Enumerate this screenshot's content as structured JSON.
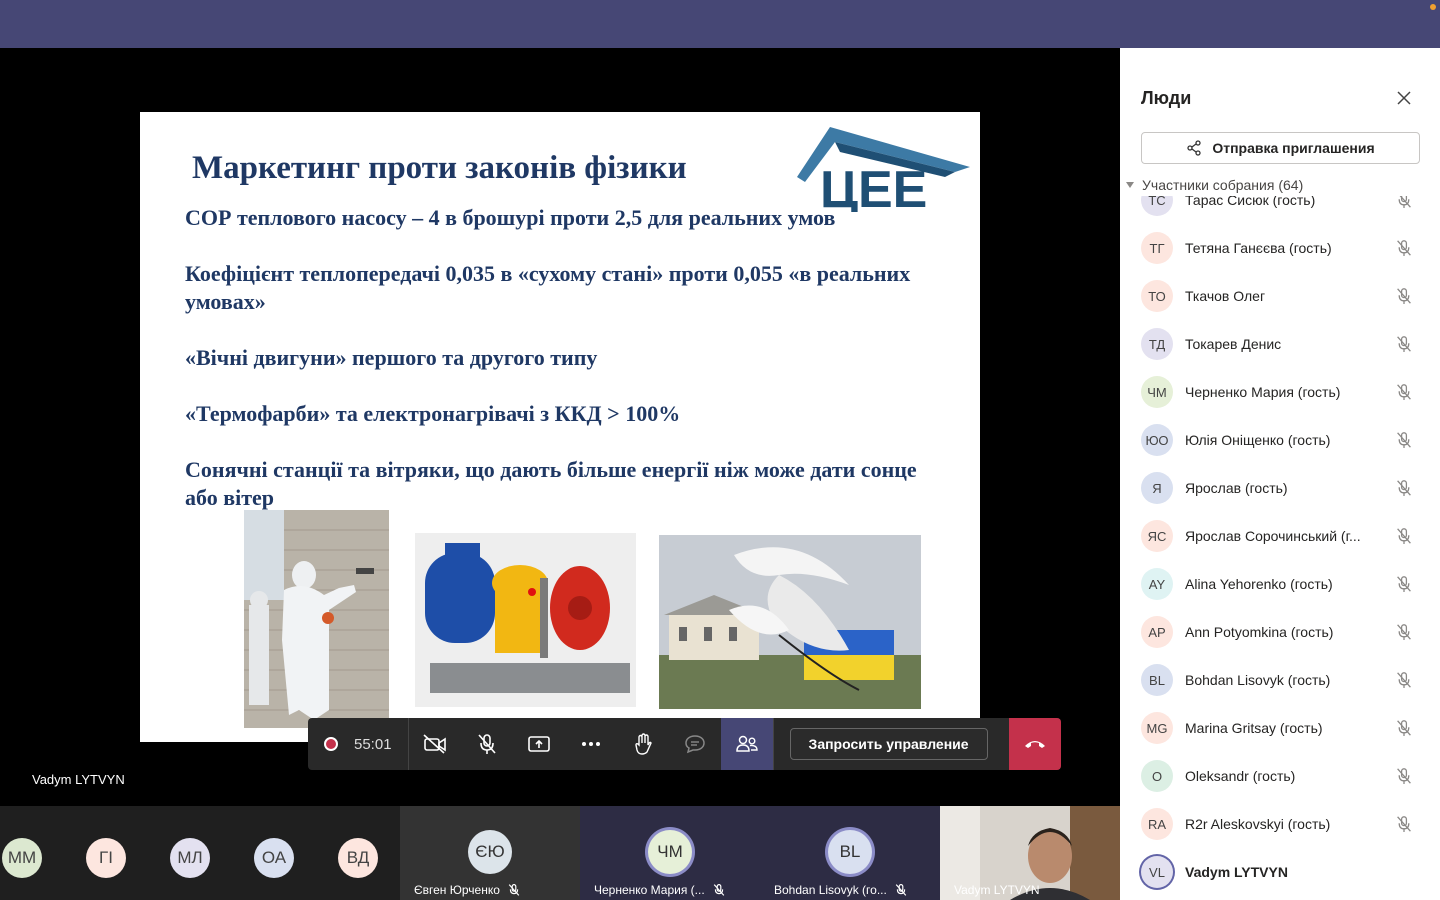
{
  "slide": {
    "title": "Маркетинг проти законів фізики",
    "logo_text": "ЦЕЕ",
    "lines": [
      "СОР теплового насосу – 4 в брошурі проти 2,5 для реальних умов",
      "Коефіцієнт теплопередачі 0,035 в «сухому стані» проти 0,055 «в реальних умовах»",
      "«Вічні двигуни» першого та другого типу",
      "«Термофарби» та електронагрівачі з ККД > 100%",
      "Сонячні станції та вітряки, що дають більше енергії ніж може дати сонце або вітер"
    ]
  },
  "presenter_name": "Vadym LYTVYN",
  "call_bar": {
    "timer": "55:01",
    "request_control": "Запросить управление"
  },
  "strip": {
    "mini_avatars": [
      "MM",
      "ГІ",
      "МЛ",
      "ОА",
      "ВД"
    ],
    "tiles": [
      {
        "initials": "ЄЮ",
        "name": "Євген Юрченко"
      },
      {
        "initials": "ЧМ",
        "name": "Черненко Мария (..."
      },
      {
        "initials": "BL",
        "name": "Bohdan Lisovyk (го..."
      },
      {
        "initials": "",
        "name": "Vadym LYTVYN"
      }
    ]
  },
  "panel": {
    "title": "Люди",
    "invite_label": "Отправка приглашения",
    "section_label": "Участники собрания (64)",
    "participants": [
      {
        "initials": "ТС",
        "name": "Тарас Сисюк (гость)",
        "color": "#e3e1f0"
      },
      {
        "initials": "ТГ",
        "name": "Тетяна Ганєєва (гость)",
        "color": "#fde6df"
      },
      {
        "initials": "ТО",
        "name": "Ткачов Олег",
        "color": "#fde6df"
      },
      {
        "initials": "ТД",
        "name": "Токарев Денис",
        "color": "#e3e1f0"
      },
      {
        "initials": "ЧМ",
        "name": "Черненко Мария (гость)",
        "color": "#e6f0d8"
      },
      {
        "initials": "ЮО",
        "name": "Юлія Оніщенко (гость)",
        "color": "#d9e0f0"
      },
      {
        "initials": "Я",
        "name": "Ярослав (гость)",
        "color": "#d9e0f0"
      },
      {
        "initials": "ЯС",
        "name": "Ярослав Сорочинський (г...",
        "color": "#fde6df"
      },
      {
        "initials": "AY",
        "name": "Alina Yehorenko (гость)",
        "color": "#dff3f3"
      },
      {
        "initials": "AP",
        "name": "Ann Potyomkina (гость)",
        "color": "#fde6df"
      },
      {
        "initials": "BL",
        "name": "Bohdan Lisovyk (гость)",
        "color": "#d9e0f0"
      },
      {
        "initials": "MG",
        "name": "Marina Gritsay (гость)",
        "color": "#fde6df"
      },
      {
        "initials": "O",
        "name": "Oleksandr (гость)",
        "color": "#dcefe4"
      },
      {
        "initials": "RA",
        "name": "R2r Aleskovskyi (гость)",
        "color": "#fde6df"
      },
      {
        "initials": "VL",
        "name": "Vadym LYTVYN",
        "color": "#e3e1f0"
      }
    ]
  },
  "colors": {
    "teams_purple": "#464775",
    "slide_text": "#1f3864",
    "hangup_red": "#c4314b"
  }
}
